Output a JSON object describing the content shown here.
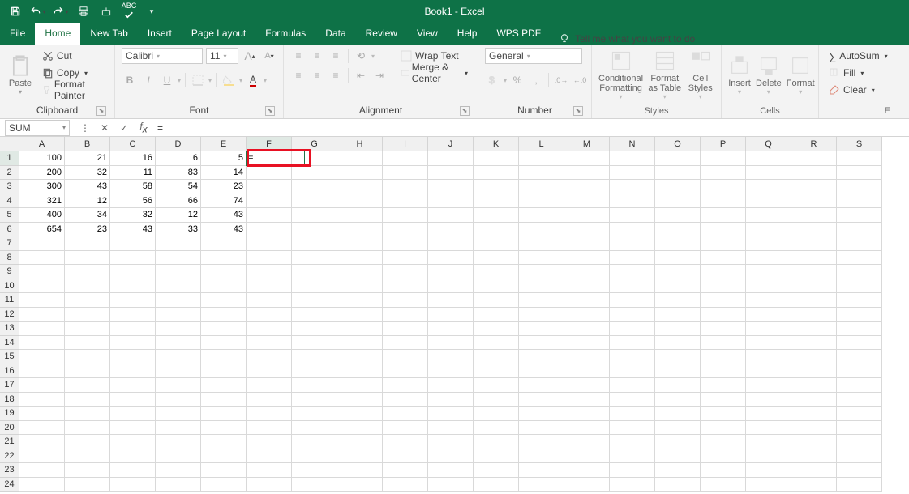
{
  "title": "Book1 - Excel",
  "qat": {
    "save": "save-icon",
    "undo": "undo-icon",
    "redo": "redo-icon"
  },
  "menu": {
    "file": "File",
    "home": "Home",
    "newtab": "New Tab",
    "insert": "Insert",
    "pagelayout": "Page Layout",
    "formulas": "Formulas",
    "data": "Data",
    "review": "Review",
    "view": "View",
    "help": "Help",
    "wpspdf": "WPS PDF",
    "tellme": "Tell me what you want to do"
  },
  "ribbon": {
    "clipboard": {
      "paste": "Paste",
      "cut": "Cut",
      "copy": "Copy",
      "formatpainter": "Format Painter",
      "label": "Clipboard"
    },
    "font": {
      "name": "Calibri",
      "size": "11",
      "label": "Font"
    },
    "alignment": {
      "wrap": "Wrap Text",
      "merge": "Merge & Center",
      "label": "Alignment"
    },
    "number": {
      "format": "General",
      "label": "Number"
    },
    "styles": {
      "cond": "Conditional Formatting",
      "table": "Format as Table",
      "cell": "Cell Styles",
      "label": "Styles"
    },
    "cells": {
      "insert": "Insert",
      "delete": "Delete",
      "format": "Format",
      "label": "Cells"
    },
    "editing": {
      "autosum": "AutoSum",
      "fill": "Fill",
      "clear": "Clear",
      "label": "E"
    }
  },
  "namebox": "SUM",
  "formula": "=",
  "columns": [
    "A",
    "B",
    "C",
    "D",
    "E",
    "F",
    "G",
    "H",
    "I",
    "J",
    "K",
    "L",
    "M",
    "N",
    "O",
    "P",
    "Q",
    "R",
    "S"
  ],
  "rows": [
    1,
    2,
    3,
    4,
    5,
    6,
    7,
    8,
    9,
    10,
    11,
    12,
    13,
    14,
    15,
    16,
    17,
    18,
    19,
    20,
    21,
    22,
    23,
    24
  ],
  "griddata": [
    [
      "100",
      "21",
      "16",
      "6",
      "5",
      "="
    ],
    [
      "200",
      "32",
      "11",
      "83",
      "14",
      ""
    ],
    [
      "300",
      "43",
      "58",
      "54",
      "23",
      ""
    ],
    [
      "321",
      "12",
      "56",
      "66",
      "74",
      ""
    ],
    [
      "400",
      "34",
      "32",
      "12",
      "43",
      ""
    ],
    [
      "654",
      "23",
      "43",
      "33",
      "43",
      ""
    ]
  ],
  "active": {
    "col": "F",
    "row": 1
  }
}
